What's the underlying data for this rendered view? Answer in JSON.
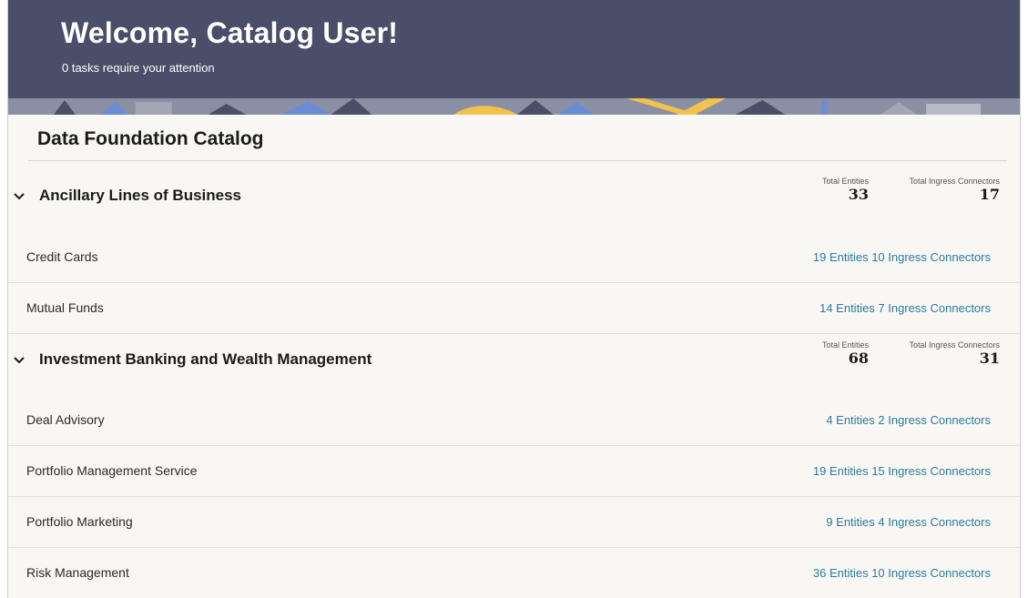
{
  "header": {
    "title": "Welcome, Catalog User!",
    "subtitle": "0 tasks require your attention"
  },
  "catalog": {
    "title": "Data Foundation Catalog",
    "groups": [
      {
        "name": "Ancillary Lines of Business",
        "total_entities_label": "Total Entities",
        "total_entities": "33",
        "total_connectors_label": "Total Ingress Connectors",
        "total_connectors": "17",
        "items": [
          {
            "name": "Credit Cards",
            "entities": "19 Entities",
            "connectors": "10 Ingress Connectors"
          },
          {
            "name": "Mutual Funds",
            "entities": "14 Entities",
            "connectors": "7 Ingress Connectors"
          }
        ]
      },
      {
        "name": "Investment Banking and Wealth Management",
        "total_entities_label": "Total Entities",
        "total_entities": "68",
        "total_connectors_label": "Total Ingress Connectors",
        "total_connectors": "31",
        "items": [
          {
            "name": "Deal Advisory",
            "entities": "4 Entities",
            "connectors": "2 Ingress Connectors"
          },
          {
            "name": "Portfolio Management Service",
            "entities": "19 Entities",
            "connectors": "15 Ingress Connectors"
          },
          {
            "name": "Portfolio Marketing",
            "entities": "9 Entities",
            "connectors": "4 Ingress Connectors"
          },
          {
            "name": "Risk Management",
            "entities": "36 Entities",
            "connectors": "10 Ingress Connectors"
          }
        ]
      }
    ]
  },
  "icons": {
    "chevron": "chevron-down-icon"
  },
  "colors": {
    "banner": "#4a4e69",
    "link": "#2a7b9b",
    "accent_yellow": "#f2c14e",
    "accent_blue": "#6c8cd5"
  }
}
